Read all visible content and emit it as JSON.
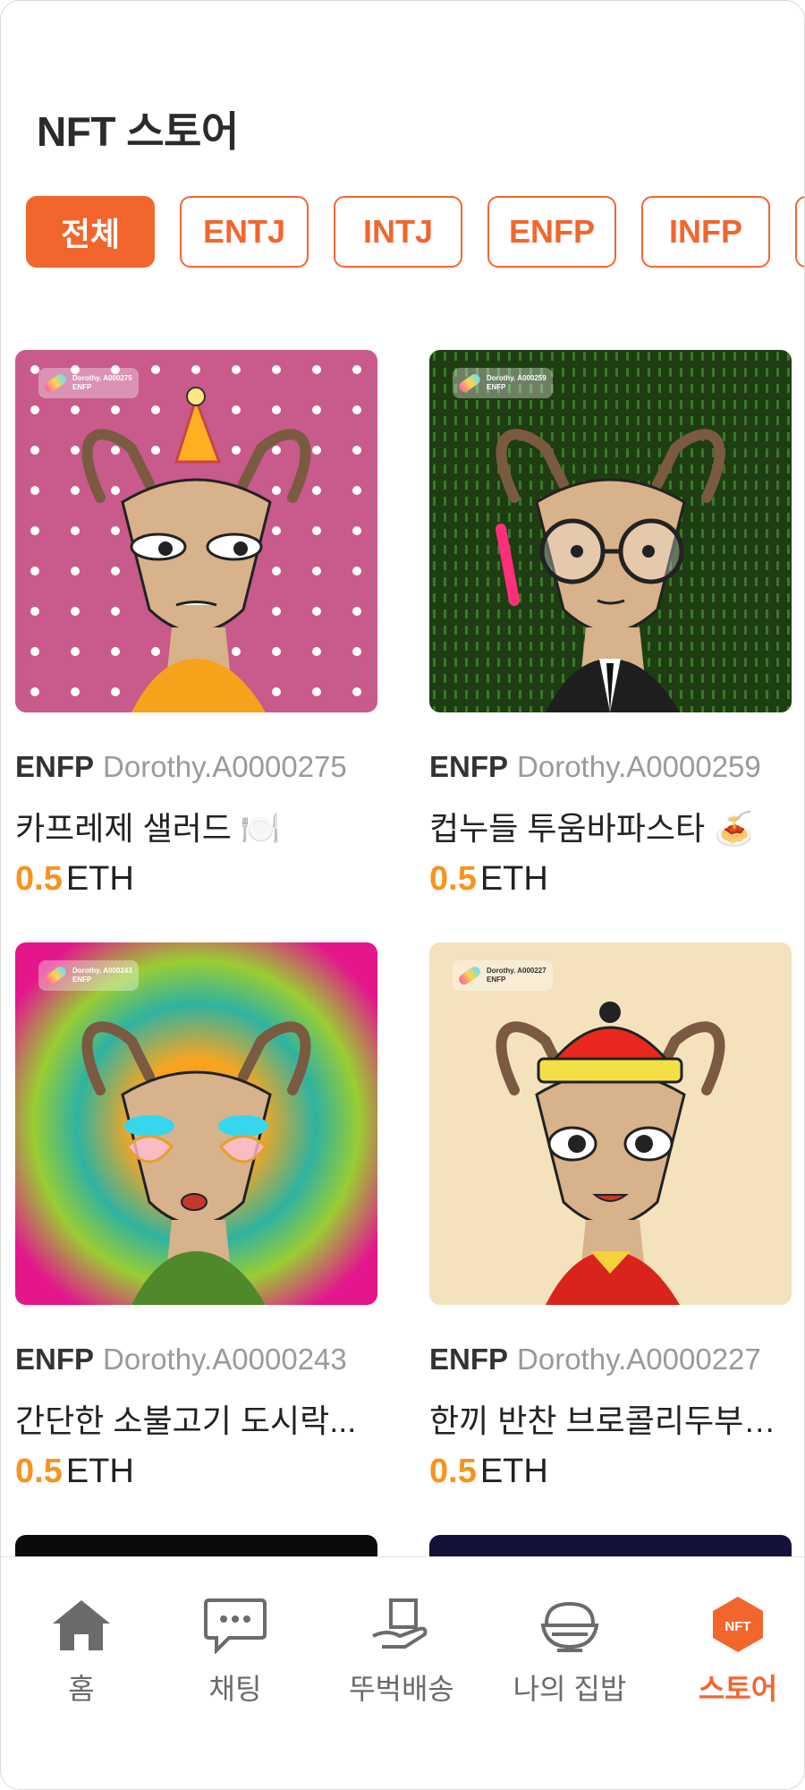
{
  "header": {
    "title": "NFT 스토어"
  },
  "filters": [
    {
      "label": "전체",
      "active": true
    },
    {
      "label": "ENTJ",
      "active": false
    },
    {
      "label": "INTJ",
      "active": false
    },
    {
      "label": "ENFP",
      "active": false
    },
    {
      "label": "INFP",
      "active": false
    },
    {
      "label": "",
      "active": false
    }
  ],
  "products": [
    {
      "mbti": "ENFP",
      "code": "Dorothy.A0000275",
      "name": "카프레제 샐러드 🍽️",
      "price": "0.5",
      "unit": "ETH",
      "tag_code": "Dorothy. A000275",
      "tag_mbti": "ENFP"
    },
    {
      "mbti": "ENFP",
      "code": "Dorothy.A0000259",
      "name": "컵누들 투움바파스타 🍝",
      "price": "0.5",
      "unit": "ETH",
      "tag_code": "Dorothy. A000259",
      "tag_mbti": "ENFP"
    },
    {
      "mbti": "ENFP",
      "code": "Dorothy.A0000243",
      "name": "간단한 소불고기 도시락...",
      "price": "0.5",
      "unit": "ETH",
      "tag_code": "Dorothy. A000243",
      "tag_mbti": "ENFP"
    },
    {
      "mbti": "ENFP",
      "code": "Dorothy.A0000227",
      "name": "한끼 반찬 브로콜리두부…",
      "price": "0.5",
      "unit": "ETH",
      "tag_code": "Dorothy. A000227",
      "tag_mbti": "ENFP"
    }
  ],
  "tabbar": {
    "items": [
      {
        "label": "홈",
        "icon": "home-icon"
      },
      {
        "label": "채팅",
        "icon": "chat-icon"
      },
      {
        "label": "뚜벅배송",
        "icon": "delivery-icon"
      },
      {
        "label": "나의 집밥",
        "icon": "rice-bowl-icon"
      },
      {
        "label": "스토어",
        "icon": "nft-store-icon",
        "badge": "NFT",
        "active": true
      }
    ]
  },
  "colors": {
    "accent": "#f2662e",
    "price": "#f7931e"
  }
}
